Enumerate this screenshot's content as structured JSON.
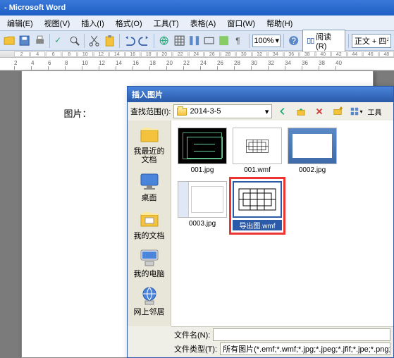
{
  "app": {
    "title": "   - Microsoft Word"
  },
  "menu": {
    "edit": "编辑(E)",
    "view": "视图(V)",
    "insert": "插入(I)",
    "format": "格式(O)",
    "tools": "工具(T)",
    "table": "表格(A)",
    "window": "窗口(W)",
    "help": "帮助(H)"
  },
  "toolbar": {
    "zoom": "100%",
    "read": "阅读(R)",
    "font_style": "正文 + 四号"
  },
  "ruler": {
    "ticks": [
      "2",
      "4",
      "6",
      "8",
      "10",
      "12",
      "14",
      "16",
      "18",
      "20",
      "22",
      "24",
      "26",
      "28",
      "30",
      "32",
      "34",
      "36",
      "38",
      "40"
    ],
    "top_markers": [
      "2",
      "4",
      "6",
      "8",
      "10",
      "12",
      "14",
      "16",
      "18",
      "20",
      "22",
      "24",
      "26",
      "28",
      "30",
      "32",
      "34",
      "36",
      "38",
      "40",
      "42",
      "44",
      "46",
      "48"
    ]
  },
  "document": {
    "text": "图片："
  },
  "dialog": {
    "title": "插入图片",
    "lookin_label": "查找范围(I):",
    "folder_name": "2014-3-5",
    "sidebar": {
      "recent": "我最近的文档",
      "desktop": "桌面",
      "mydocs": "我的文档",
      "mycomputer": "我的电脑",
      "network": "网上邻居"
    },
    "files": [
      {
        "name": "001.jpg",
        "kind": "cad-dark",
        "selected": false
      },
      {
        "name": "001.wmf",
        "kind": "cad-light-small",
        "selected": false
      },
      {
        "name": "0002.jpg",
        "kind": "screenshot",
        "selected": false
      },
      {
        "name": "0003.jpg",
        "kind": "ppt",
        "selected": false
      },
      {
        "name": "导出图.wmf",
        "kind": "cad-light",
        "selected": true
      }
    ],
    "filename_label": "文件名(N):",
    "filetype_label": "文件类型(T):",
    "filetype_value": "所有图片(*.emf;*.wmf;*.jpg;*.jpeg;*.jfif;*.jpe;*.png;*.bmp;*.dib;*.rle"
  }
}
